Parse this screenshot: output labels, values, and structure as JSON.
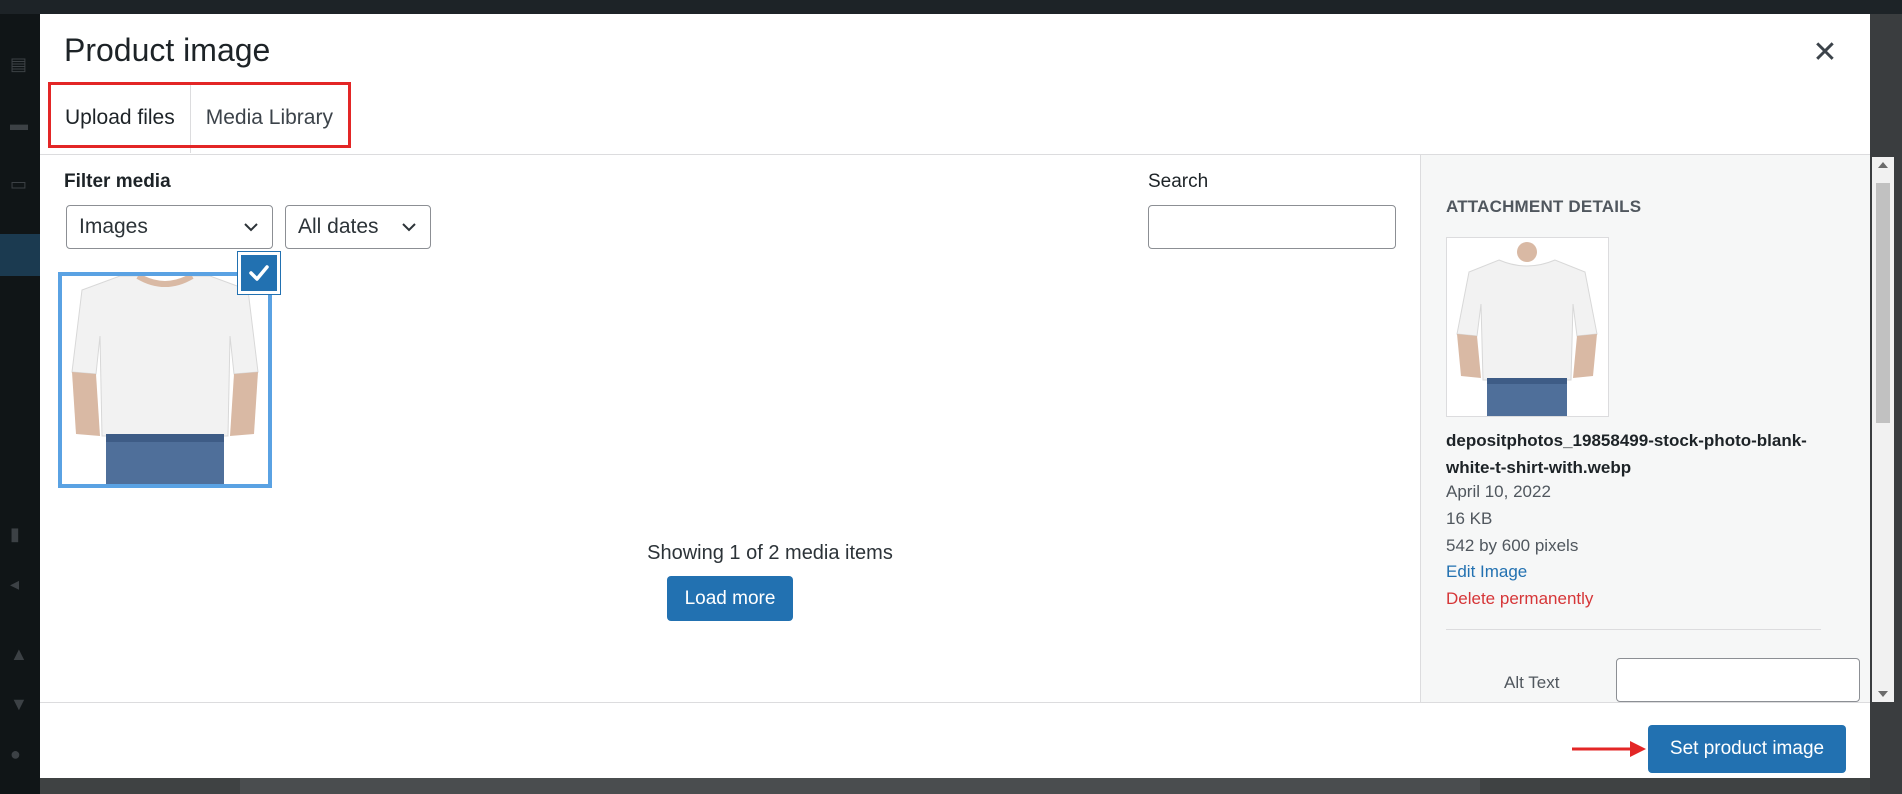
{
  "modal": {
    "title": "Product image",
    "tabs": [
      {
        "label": "Upload files"
      },
      {
        "label": "Media Library"
      }
    ]
  },
  "filter": {
    "label": "Filter media",
    "type_selected": "Images",
    "date_selected": "All dates"
  },
  "search": {
    "label": "Search",
    "value": ""
  },
  "grid": {
    "showing_text": "Showing 1 of 2 media items",
    "load_more_label": "Load more"
  },
  "details": {
    "heading": "ATTACHMENT DETAILS",
    "file_name": "depositphotos_19858499-stock-photo-blank-white-t-shirt-with.webp",
    "date": "April 10, 2022",
    "size": "16 KB",
    "dimensions": "542 by 600 pixels",
    "edit_link": "Edit Image",
    "delete_link": "Delete permanently",
    "alt_text_label": "Alt Text",
    "alt_text_value": ""
  },
  "footer": {
    "primary_button": "Set product image"
  },
  "colors": {
    "primary": "#2271b1",
    "danger": "#d63638",
    "highlight": "#e32626"
  }
}
